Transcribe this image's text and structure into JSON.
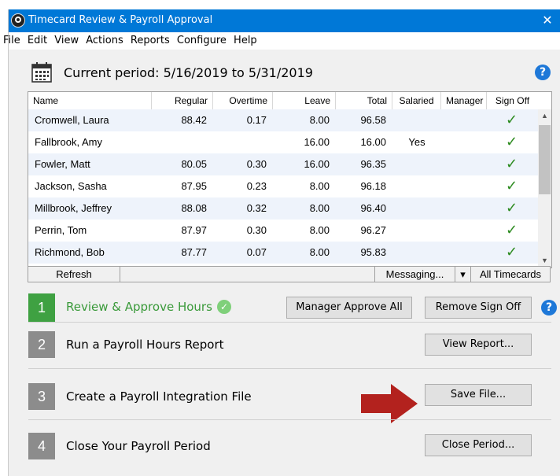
{
  "window": {
    "title": "Timecard Review & Payroll Approval",
    "close_glyph": "✕"
  },
  "menu": [
    "File",
    "Edit",
    "View",
    "Actions",
    "Reports",
    "Configure",
    "Help"
  ],
  "period": {
    "label": "Current period: 5/16/2019 to 5/31/2019",
    "icon": "calendar-icon"
  },
  "help_glyph": "?",
  "grid": {
    "columns": [
      "Name",
      "Regular",
      "Overtime",
      "Leave",
      "Total",
      "Salaried",
      "Manager",
      "Sign Off"
    ],
    "rows": [
      {
        "name": "Cromwell, Laura",
        "regular": "88.42",
        "overtime": "0.17",
        "leave": "8.00",
        "total": "96.58",
        "salaried": "",
        "manager": "",
        "signoff": "✓"
      },
      {
        "name": "Fallbrook, Amy",
        "regular": "",
        "overtime": "",
        "leave": "16.00",
        "total": "16.00",
        "salaried": "Yes",
        "manager": "",
        "signoff": "✓"
      },
      {
        "name": "Fowler, Matt",
        "regular": "80.05",
        "overtime": "0.30",
        "leave": "16.00",
        "total": "96.35",
        "salaried": "",
        "manager": "",
        "signoff": "✓"
      },
      {
        "name": "Jackson, Sasha",
        "regular": "87.95",
        "overtime": "0.23",
        "leave": "8.00",
        "total": "96.18",
        "salaried": "",
        "manager": "",
        "signoff": "✓"
      },
      {
        "name": "Millbrook, Jeffrey",
        "regular": "88.08",
        "overtime": "0.32",
        "leave": "8.00",
        "total": "96.40",
        "salaried": "",
        "manager": "",
        "signoff": "✓"
      },
      {
        "name": "Perrin, Tom",
        "regular": "87.97",
        "overtime": "0.30",
        "leave": "8.00",
        "total": "96.27",
        "salaried": "",
        "manager": "",
        "signoff": "✓"
      },
      {
        "name": "Richmond, Bob",
        "regular": "87.77",
        "overtime": "0.07",
        "leave": "8.00",
        "total": "95.83",
        "salaried": "",
        "manager": "",
        "signoff": "✓"
      }
    ],
    "scroll_up": "▲",
    "scroll_down": "▼"
  },
  "gridbar": {
    "refresh": "Refresh",
    "messaging": "Messaging...",
    "messaging_arrow": "▾",
    "all_timecards": "All Timecards"
  },
  "steps": [
    {
      "number": "1",
      "label": "Review & Approve Hours",
      "color": "#3fa142",
      "label_color": "#3a9a3a",
      "done_glyph": "✓"
    },
    {
      "number": "2",
      "label": "Run a Payroll Hours Report",
      "color": "#8c8c8c"
    },
    {
      "number": "3",
      "label": "Create a Payroll Integration File",
      "color": "#8c8c8c"
    },
    {
      "number": "4",
      "label": "Close Your Payroll Period",
      "color": "#8c8c8c"
    }
  ],
  "buttons": {
    "manager_approve_all": "Manager Approve All",
    "remove_sign_off": "Remove Sign Off",
    "view_report": "View Report...",
    "save_file": "Save File...",
    "close_period": "Close Period..."
  },
  "colors": {
    "titlebar": "#0078d7",
    "help": "#1e78d8",
    "arrow": "#b3221e",
    "check": "#2b8a1e"
  }
}
